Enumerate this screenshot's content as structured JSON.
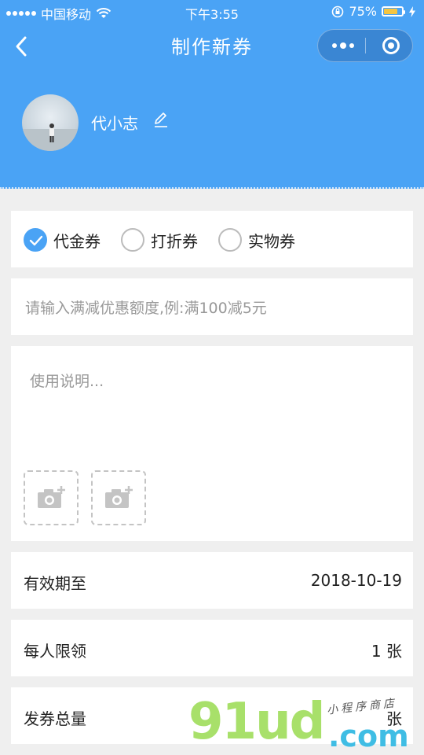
{
  "status_bar": {
    "carrier": "中国移动",
    "time": "下午3:55",
    "battery": "75%"
  },
  "nav": {
    "title": "制作新券"
  },
  "profile": {
    "name": "代小志"
  },
  "coupon_types": [
    {
      "label": "代金券",
      "selected": true
    },
    {
      "label": "打折券",
      "selected": false
    },
    {
      "label": "实物券",
      "selected": false
    }
  ],
  "amount": {
    "placeholder": "请输入满减优惠额度,例:满100减5元",
    "value": ""
  },
  "description": {
    "placeholder": "使用说明...",
    "value": ""
  },
  "rows": {
    "expiry": {
      "label": "有效期至",
      "value": "2018-10-19"
    },
    "limit": {
      "label": "每人限领",
      "value": "1 张"
    },
    "total": {
      "label": "发券总量",
      "value": "张"
    }
  },
  "watermark": {
    "main": "91ud",
    "domain": ".com",
    "handwriting": "小程序商店"
  },
  "colors": {
    "primary": "#4aa3f5",
    "background": "#efefef"
  }
}
